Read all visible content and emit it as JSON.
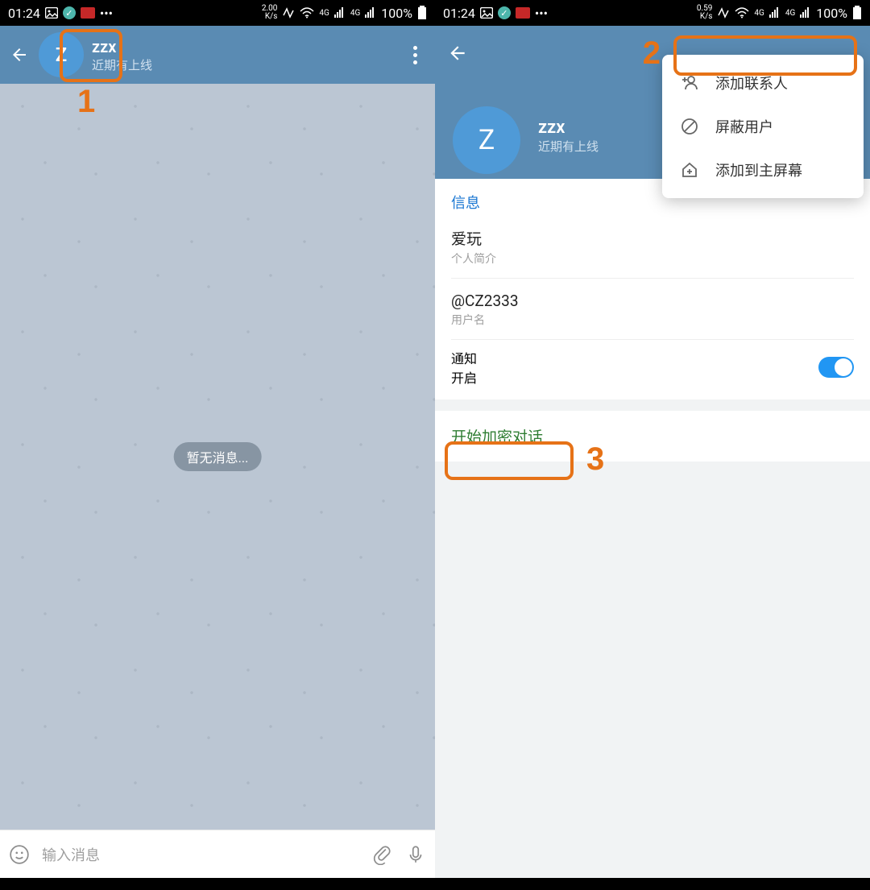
{
  "statusbar": {
    "time": "01:24",
    "speed_left": "2.00",
    "speed_right": "0.59",
    "speed_unit": "K/s",
    "net1": "4G",
    "net2": "4G",
    "battery": "100%",
    "dots": "•••"
  },
  "left": {
    "header": {
      "name": "zzx",
      "status": "近期有上线",
      "avatar_letter": "Z"
    },
    "body": {
      "empty_pill": "暂无消息..."
    },
    "input": {
      "placeholder": "输入消息"
    }
  },
  "right": {
    "header": {
      "name": "zzx",
      "status": "近期有上线",
      "avatar_letter": "Z"
    },
    "popup": {
      "add_contact": "添加联系人",
      "block_user": "屏蔽用户",
      "add_to_home": "添加到主屏幕"
    },
    "info": {
      "section_title": "信息",
      "bio_value": "爱玩",
      "bio_label": "个人简介",
      "username_value": "@CZ2333",
      "username_label": "用户名",
      "notif_title": "通知",
      "notif_value": "开启"
    },
    "secret_chat": "开始加密对话"
  },
  "annotations": {
    "one": "1",
    "two": "2",
    "three": "3"
  }
}
